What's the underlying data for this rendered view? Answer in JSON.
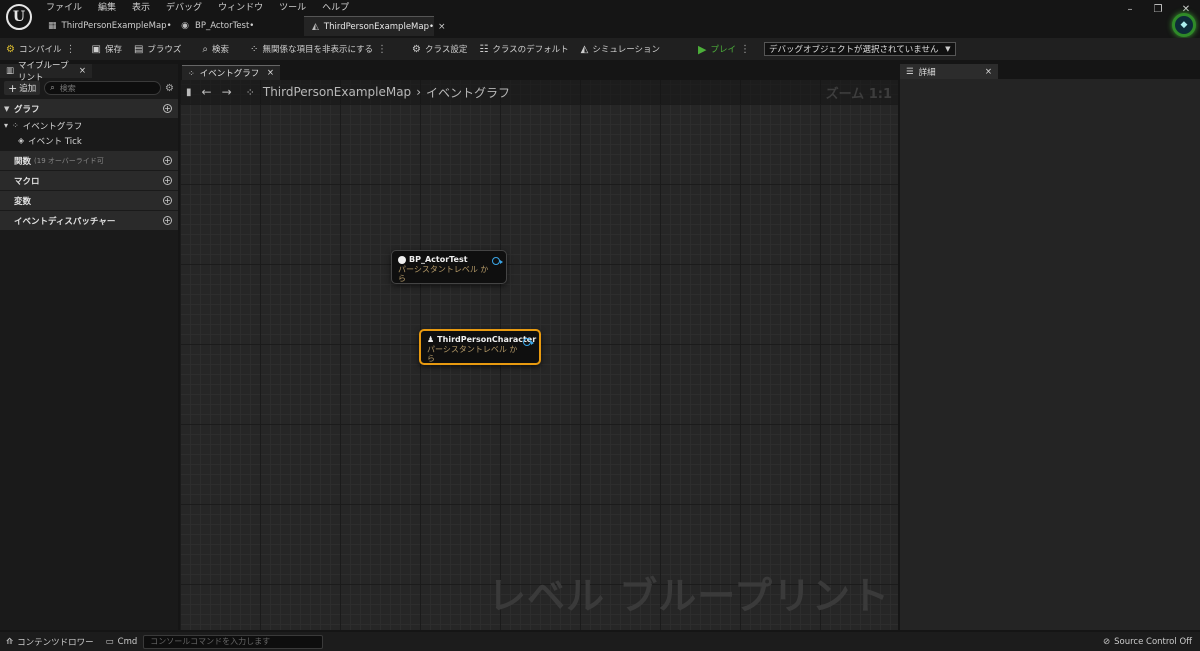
{
  "menu": [
    "ファイル",
    "編集",
    "表示",
    "デバッグ",
    "ウィンドウ",
    "ツール",
    "ヘルプ"
  ],
  "doc_tabs": [
    {
      "label": "ThirdPersonExampleMap•",
      "icon": "level-icon",
      "active": false
    },
    {
      "label": "BP_ActorTest•",
      "icon": "blueprint-icon",
      "active": false
    },
    {
      "label": "ThirdPersonExampleMap•",
      "icon": "level-blueprint-icon",
      "active": true
    }
  ],
  "toolbar": {
    "compile": "コンパイル",
    "save": "保存",
    "browse": "ブラウズ",
    "search": "検索",
    "hide_unrelated": "無関係な項目を非表示にする",
    "class_settings": "クラス設定",
    "class_defaults": "クラスのデフォルト",
    "simulation": "シミュレーション",
    "play": "プレイ",
    "debug_object": "デバッグオブジェクトが選択されていません"
  },
  "left_panel": {
    "tab_label": "マイブループリント",
    "add_label": "追加",
    "search_placeholder": "検索",
    "categories": {
      "graphs": "グラフ",
      "event_graph": "イベントグラフ",
      "event_tick": "イベント Tick",
      "functions": "関数",
      "functions_sub": "(19 オーバーライド可",
      "macros": "マクロ",
      "variables": "変数",
      "dispatchers": "イベントディスパッチャー"
    }
  },
  "graph": {
    "tab_label": "イベントグラフ",
    "breadcrumb_root": "ThirdPersonExampleMap",
    "breadcrumb_current": "イベントグラフ",
    "zoom": "ズーム 1:1",
    "watermark": "レベル ブループリント",
    "nodes": [
      {
        "title": "BP_ActorTest",
        "subtitle": "パーシスタントレベル から",
        "selected": false
      },
      {
        "title": "ThirdPersonCharacter",
        "subtitle": "パーシスタントレベル から",
        "selected": true
      }
    ]
  },
  "details": {
    "tab_label": "詳細"
  },
  "statusbar": {
    "content_drawer": "コンテンツドロワー",
    "cmd": "Cmd",
    "console_placeholder": "コンソールコマンドを入力します",
    "source_control": "Source Control Off"
  },
  "colors": {
    "accent_selected": "#e89a10",
    "pin_blue": "#3aa6e8",
    "play_green": "#4caf3a"
  }
}
